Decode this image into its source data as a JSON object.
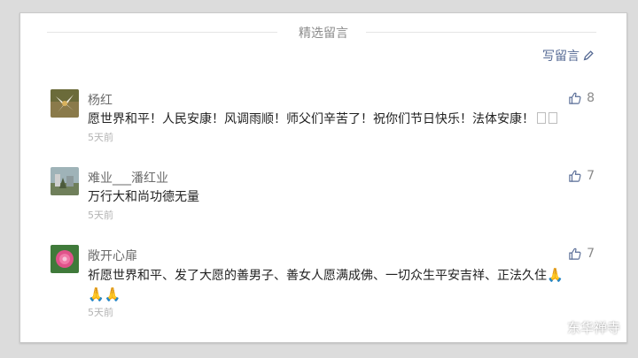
{
  "header": {
    "title": "精选留言",
    "write_label": "写留言"
  },
  "comments": [
    {
      "name": "杨红",
      "content": "愿世界和平！人民安康！风调雨顺！师父们辛苦了！祝你们节日快乐！法体安康！",
      "time": "5天前",
      "likes": "8"
    },
    {
      "name": "难业___潘红业",
      "content": "万行大和尚功德无量",
      "time": "5天前",
      "likes": "7"
    },
    {
      "name": "敞开心扉",
      "content": "祈愿世界和平、发了大愿的善男子、善女人愿满成佛、一切众生平安吉祥、正法久住",
      "time": "5天前",
      "likes": "7"
    }
  ],
  "watermark": {
    "text": "东华禅寺"
  },
  "colors": {
    "link": "#576b95",
    "name": "#6b6b6b",
    "time": "#b3b3b3",
    "like_icon": "#576b95"
  },
  "icons": {
    "write": "pencil-icon",
    "like": "thumbs-up-icon",
    "emoji": "praying-hands-icon",
    "watermark": "wechat-icon"
  }
}
